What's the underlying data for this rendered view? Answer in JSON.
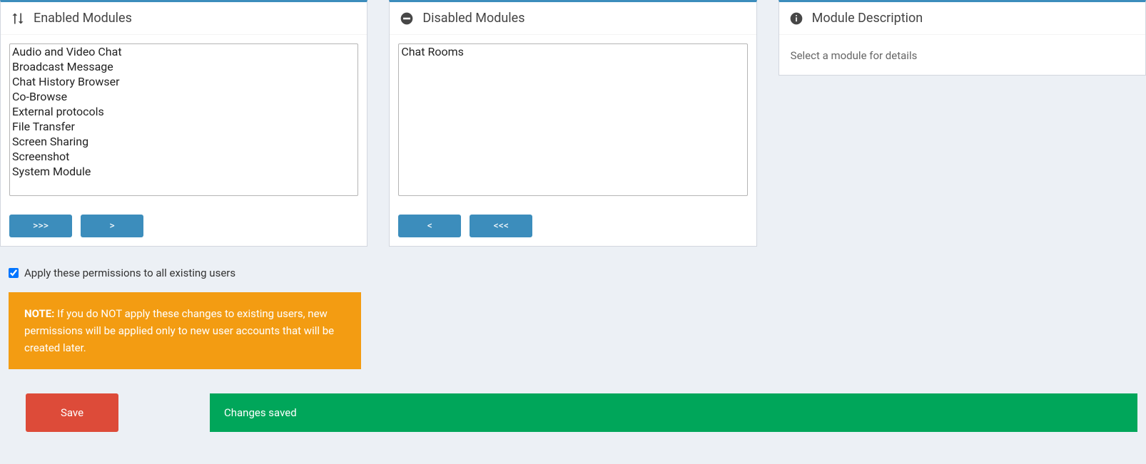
{
  "enabled": {
    "title": "Enabled Modules",
    "items": [
      "Audio and Video Chat",
      "Broadcast Message",
      "Chat History Browser",
      "Co-Browse",
      "External protocols",
      "File Transfer",
      "Screen Sharing",
      "Screenshot",
      "System Module"
    ],
    "btn_all": ">>>",
    "btn_one": ">"
  },
  "disabled": {
    "title": "Disabled Modules",
    "items": [
      "Chat Rooms"
    ],
    "btn_one": "<",
    "btn_all": "<<<"
  },
  "description": {
    "title": "Module Description",
    "placeholder": "Select a module for details"
  },
  "apply": {
    "checked": true,
    "label": "Apply these permissions to all existing users"
  },
  "note": {
    "prefix": "NOTE:",
    "text": " If you do NOT apply these changes to existing users, new permissions will be applied only to new user accounts that will be created later."
  },
  "save": {
    "label": "Save"
  },
  "alert": {
    "text": "Changes saved"
  }
}
